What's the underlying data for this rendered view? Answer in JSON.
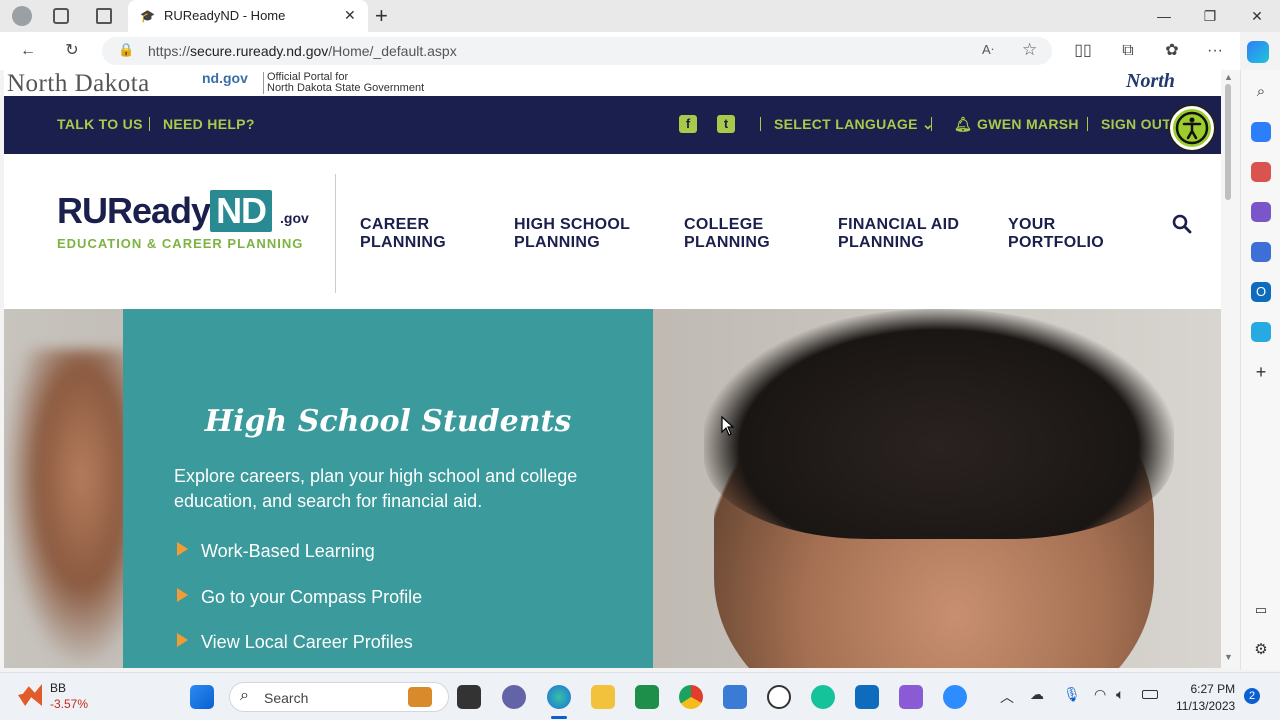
{
  "browser": {
    "tab_title": "RUReadyND - Home",
    "url_prefix": "https://",
    "url_host": "secure.ruready.nd.gov",
    "url_path": "/Home/_default.aspx"
  },
  "gov_strip": {
    "state_name": "North Dakota",
    "ndgov": "nd.gov",
    "portal_line1": "Official Portal for",
    "portal_line2": "North Dakota State Government",
    "logo_script": "North Dakota"
  },
  "topbar": {
    "talk": "TALK TO US",
    "help": "NEED HELP?",
    "language": "SELECT LANGUAGE",
    "user": "GWEN MARSH",
    "signout": "SIGN OUT"
  },
  "logo": {
    "main": "RUReady",
    "nd": "ND",
    "gov": ".gov",
    "sub": "EDUCATION & CAREER PLANNING"
  },
  "nav": [
    {
      "line1": "CAREER",
      "line2": "PLANNING"
    },
    {
      "line1": "HIGH SCHOOL",
      "line2": "PLANNING"
    },
    {
      "line1": "COLLEGE",
      "line2": "PLANNING"
    },
    {
      "line1": "FINANCIAL AID",
      "line2": "PLANNING"
    },
    {
      "line1": "YOUR",
      "line2": "PORTFOLIO"
    }
  ],
  "hero": {
    "title": "High School Students",
    "text": "Explore careers, plan your high school and college education, and search for financial aid.",
    "links": [
      "Work-Based Learning",
      "Go to your Compass Profile",
      "View Local Career Profiles"
    ]
  },
  "taskbar": {
    "stock_name": "BB",
    "stock_change": "-3.57%",
    "search_placeholder": "Search",
    "time": "6:27 PM",
    "date": "11/13/2023",
    "notif_count": "2"
  },
  "colors": {
    "navy": "#1b1f4d",
    "green": "#a8c94a",
    "teal": "#3a9a9c",
    "orange": "#f39c33"
  }
}
